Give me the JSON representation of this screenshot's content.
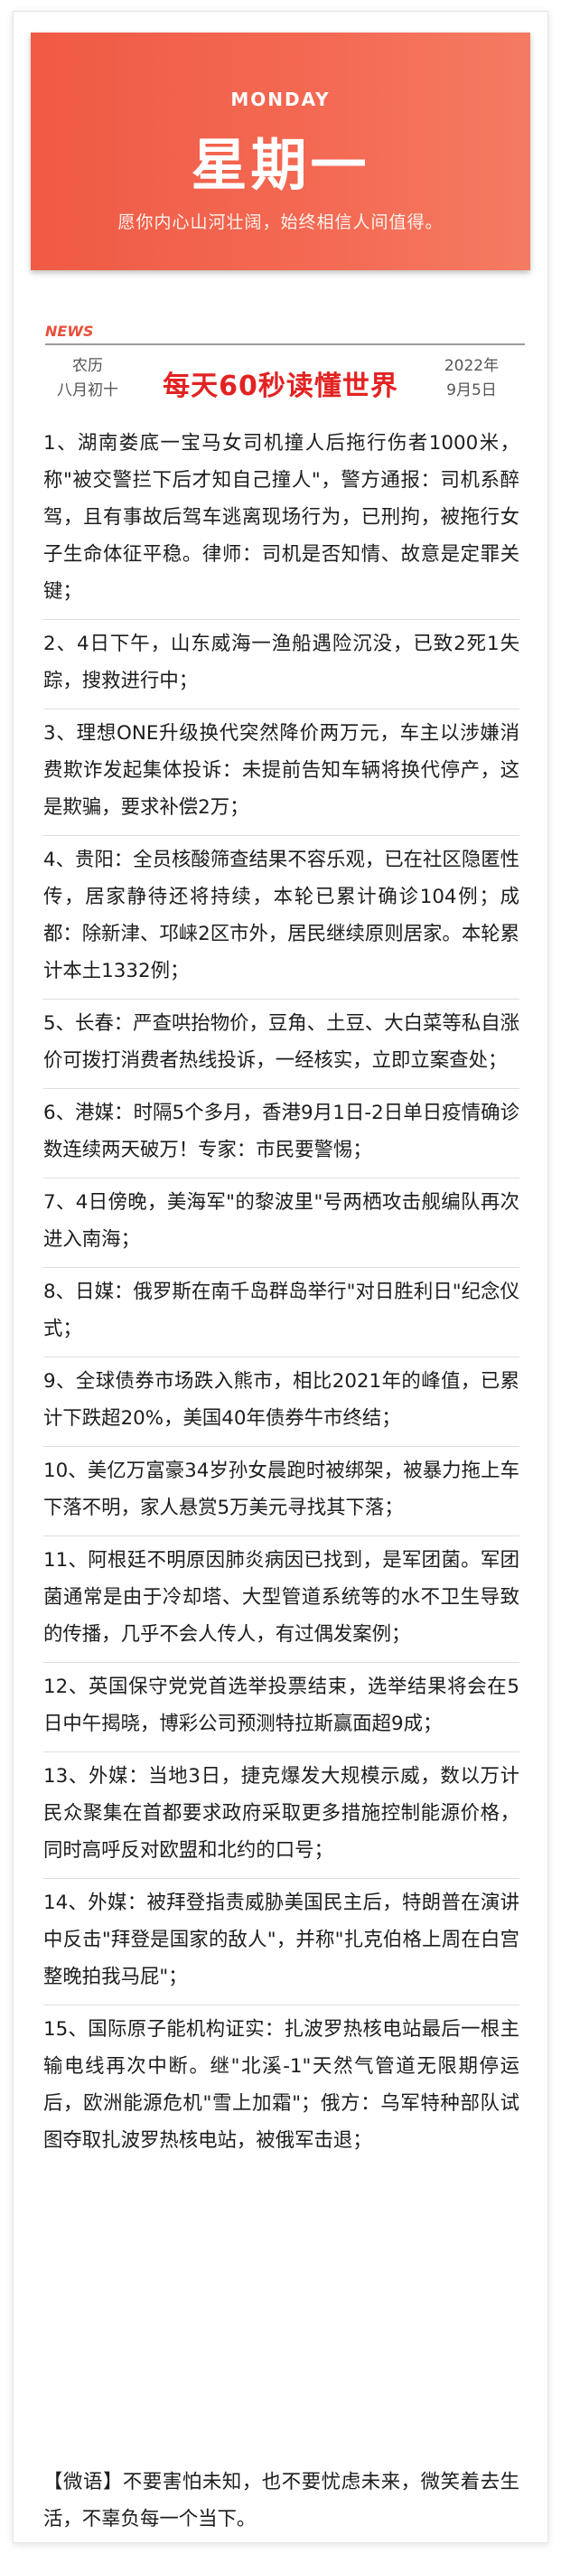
{
  "banner": {
    "day_en": "MONDAY",
    "day_cn": "星期一",
    "motto": "愿你内心山河壮阔，始终相信人间值得。"
  },
  "section_label": "NEWS",
  "lunar": {
    "label": "农历",
    "date": "八月初十"
  },
  "headline": "每天60秒读懂世界",
  "gregorian": {
    "year": "2022年",
    "date": "9月5日"
  },
  "news": [
    "1、湖南娄底一宝马女司机撞人后拖行伤者1000米，称\"被交警拦下后才知自己撞人\"，警方通报：司机系醉驾，且有事故后驾车逃离现场行为，已刑拘，被拖行女子生命体征平稳。律师：司机是否知情、故意是定罪关键；",
    "2、4日下午，山东威海一渔船遇险沉没，已致2死1失踪，搜救进行中；",
    "3、理想ONE升级换代突然降价两万元，车主以涉嫌消费欺诈发起集体投诉：未提前告知车辆将换代停产，这是欺骗，要求补偿2万；",
    "4、贵阳：全员核酸筛查结果不容乐观，已在社区隐匿性传，居家静待还将持续，本轮已累计确诊104例；成都：除新津、邛崃2区市外，居民继续原则居家。本轮累计本土1332例；",
    "5、长春：严查哄抬物价，豆角、土豆、大白菜等私自涨价可拨打消费者热线投诉，一经核实，立即立案查处；",
    "6、港媒：时隔5个多月，香港9月1日-2日单日疫情确诊数连续两天破万！专家：市民要警惕；",
    "7、4日傍晚，美海军\"的黎波里\"号两栖攻击舰编队再次进入南海；",
    "8、日媒：俄罗斯在南千岛群岛举行\"对日胜利日\"纪念仪式；",
    "9、全球债券市场跌入熊市，相比2021年的峰值，已累计下跌超20%，美国40年债券牛市终结；",
    "10、美亿万富豪34岁孙女晨跑时被绑架，被暴力拖上车下落不明，家人悬赏5万美元寻找其下落；",
    "11、阿根廷不明原因肺炎病因已找到，是军团菌。军团菌通常是由于冷却塔、大型管道系统等的水不卫生导致的传播，几乎不会人传人，有过偶发案例；",
    "12、英国保守党党首选举投票结束，选举结果将会在5日中午揭晓，博彩公司预测特拉斯赢面超9成；",
    "13、外媒：当地3日，捷克爆发大规模示威，数以万计民众聚集在首都要求政府采取更多措施控制能源价格，同时高呼反对欧盟和北约的口号；",
    "14、外媒：被拜登指责威胁美国民主后，特朗普在演讲中反击\"拜登是国家的敌人\"，并称\"扎克伯格上周在白宫整晚拍我马屁\"；",
    "15、国际原子能机构证实：扎波罗热核电站最后一根主输电线再次中断。继\"北溪-1\"天然气管道无限期停运后，欧洲能源危机\"雪上加霜\"；俄方：乌军特种部队试图夺取扎波罗热核电站，被俄军击退；"
  ],
  "quote": "【微语】不要害怕未知，也不要忧虑未来，微笑着去生活，不辜负每一个当下。"
}
